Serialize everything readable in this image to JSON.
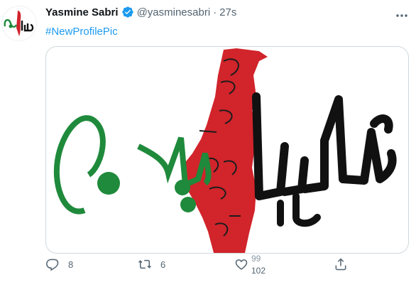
{
  "tweet": {
    "author_name": "Yasmine Sabri",
    "handle": "@yasminesabri",
    "separator": "·",
    "time": "27s",
    "hashtag": "#NewProfilePic"
  },
  "actions": {
    "reply_count": "8",
    "retweet_count": "6",
    "like_count_old": "99",
    "like_count": "102"
  },
  "colors": {
    "verified": "#1d9bf0",
    "link": "#1d9bf0",
    "muted": "#536471",
    "art_red": "#d1242b",
    "art_green": "#1f8a3b"
  },
  "icons": {
    "verified": "verified-badge-icon",
    "more": "more-icon",
    "reply": "reply-icon",
    "retweet": "retweet-icon",
    "like": "heart-icon",
    "share": "share-icon"
  }
}
